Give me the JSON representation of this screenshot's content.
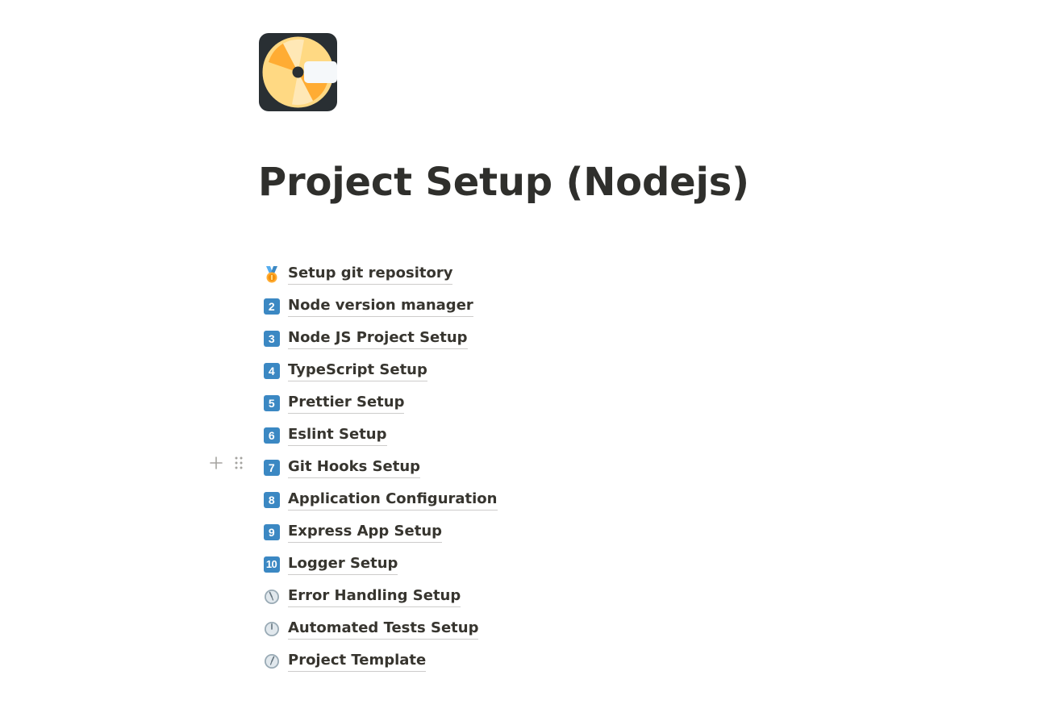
{
  "page": {
    "title": "Project Setup (Nodejs)",
    "icon": "dvd-disc-icon"
  },
  "links": [
    {
      "emoji": "medal-icon",
      "label": "Setup git repository"
    },
    {
      "emoji": "keycap-2",
      "keycap": "2",
      "label": "Node version manager"
    },
    {
      "emoji": "keycap-3",
      "keycap": "3",
      "label": "Node JS Project Setup"
    },
    {
      "emoji": "keycap-4",
      "keycap": "4",
      "label": "TypeScript Setup"
    },
    {
      "emoji": "keycap-5",
      "keycap": "5",
      "label": "Prettier Setup"
    },
    {
      "emoji": "keycap-6",
      "keycap": "6",
      "label": "Eslint Setup"
    },
    {
      "emoji": "keycap-7",
      "keycap": "7",
      "label": "Git Hooks Setup"
    },
    {
      "emoji": "keycap-8",
      "keycap": "8",
      "label": "Application Configuration"
    },
    {
      "emoji": "keycap-9",
      "keycap": "9",
      "label": "Express App Setup"
    },
    {
      "emoji": "keycap-10",
      "keycap": "10",
      "label": "Logger Setup"
    },
    {
      "emoji": "clock-icon",
      "label": "Error Handling Setup"
    },
    {
      "emoji": "clock-icon",
      "label": "Automated Tests Setup"
    },
    {
      "emoji": "clock-icon",
      "label": "Project Template"
    }
  ],
  "block_handle": {
    "add_icon": "plus-icon",
    "drag_icon": "drag-handle-icon"
  }
}
